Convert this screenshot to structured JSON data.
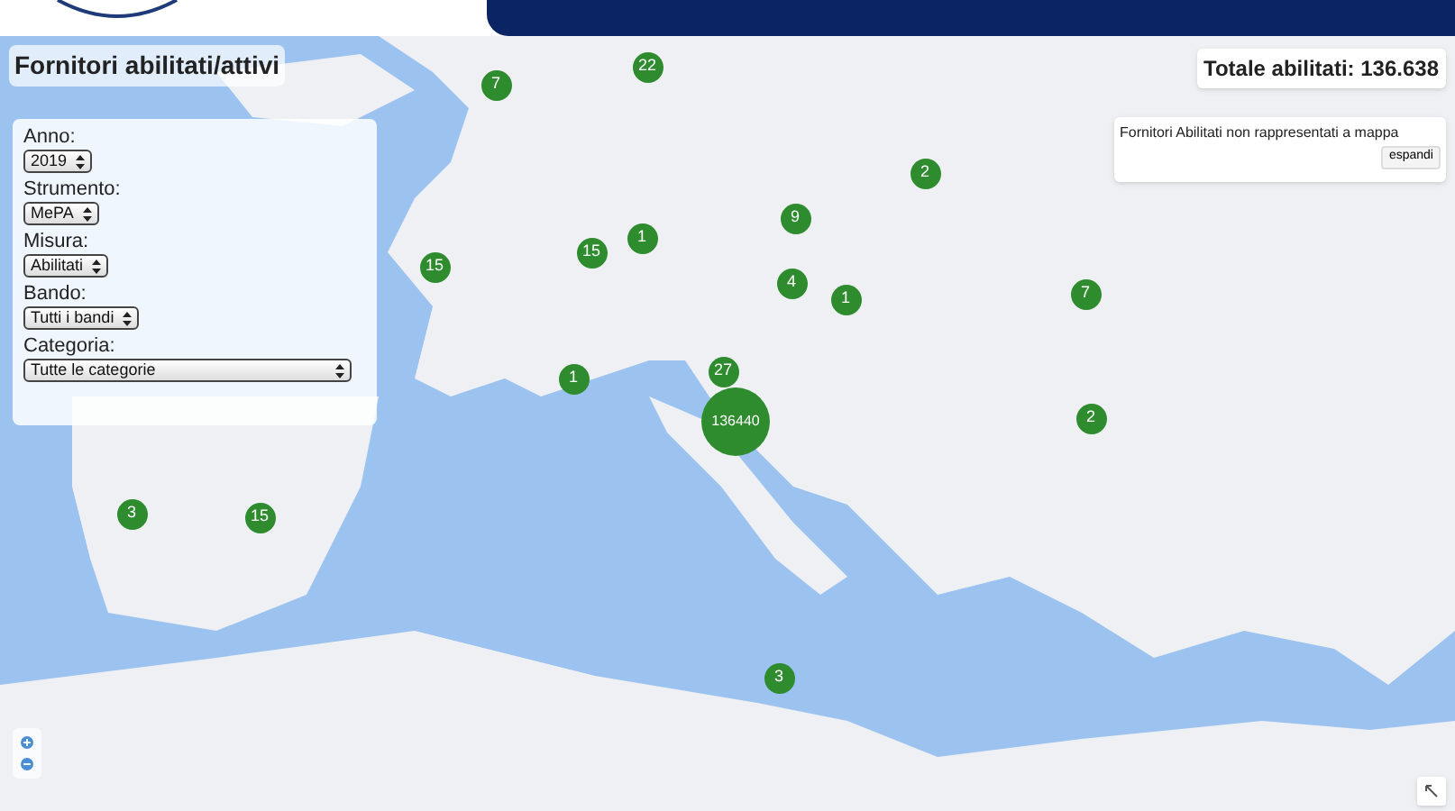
{
  "title": "Fornitori abilitati/attivi",
  "filters": [
    {
      "label": "Anno:",
      "value": "2019"
    },
    {
      "label": "Strumento:",
      "value": "MePA"
    },
    {
      "label": "Misura:",
      "value": "Abilitati"
    },
    {
      "label": "Bando:",
      "value": "Tutti i bandi"
    },
    {
      "label": "Categoria:",
      "value": "Tutte le categorie"
    }
  ],
  "total": "Totale abilitati: 136.638",
  "unmapped_panel": {
    "title": "Fornitori Abilitati non rappresentati a mappa",
    "button": "espandi"
  },
  "markers": [
    {
      "label": "7"
    },
    {
      "label": "22"
    },
    {
      "label": "2"
    },
    {
      "label": "9"
    },
    {
      "label": "1"
    },
    {
      "label": "15"
    },
    {
      "label": "15"
    },
    {
      "label": "4"
    },
    {
      "label": "1"
    },
    {
      "label": "7"
    },
    {
      "label": "27"
    },
    {
      "label": "1"
    },
    {
      "label": "136440"
    },
    {
      "label": "2"
    },
    {
      "label": "3"
    },
    {
      "label": "15"
    },
    {
      "label": "3"
    }
  ]
}
